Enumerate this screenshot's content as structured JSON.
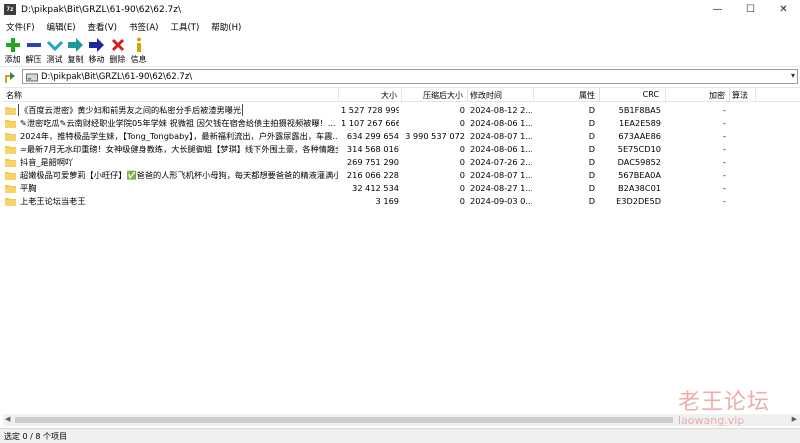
{
  "window": {
    "app_icon_text": "7z",
    "title": "D:\\pikpak\\Bit\\GRZL\\61-90\\62\\62.7z\\",
    "controls": [
      "—",
      "☐",
      "✕"
    ]
  },
  "menu": [
    "文件(F)",
    "编辑(E)",
    "查看(V)",
    "书签(A)",
    "工具(T)",
    "帮助(H)"
  ],
  "toolbar": [
    {
      "label": "添加",
      "icon": "add-icon",
      "color": "#22a722"
    },
    {
      "label": "解压",
      "icon": "extract-icon",
      "color": "#2a3fc9"
    },
    {
      "label": "测试",
      "icon": "test-icon",
      "color": "#20a8c8"
    },
    {
      "label": "复制",
      "icon": "copy-icon",
      "color": "#1a9a9a"
    },
    {
      "label": "移动",
      "icon": "move-icon",
      "color": "#1b2a9a"
    },
    {
      "label": "删除",
      "icon": "delete-icon",
      "color": "#d42020"
    },
    {
      "label": "信息",
      "icon": "info-icon",
      "color": "#d4a400"
    }
  ],
  "address": {
    "path": "D:\\pikpak\\Bit\\GRZL\\61-90\\62\\62.7z\\"
  },
  "columns": {
    "name": "名称",
    "size": "大小",
    "packed": "压缩后大小",
    "modified": "修改时间",
    "attributes": "属性",
    "crc": "CRC",
    "encrypted": "加密",
    "method": "算法"
  },
  "rows": [
    {
      "name": "《百度云泄密》黄少妇和前男友之间的私密分手后被渣男曝光",
      "size": "1 527 728 999",
      "packed": "0",
      "modified": "2024-08-12 2...",
      "attr": "D",
      "crc": "5B1F8BA5",
      "enc": "-",
      "selected": true
    },
    {
      "name": "✎泄密吃瓜✎云南财经职业学院05年学妹 祝微祖 因欠钱在宿舍给债主拍摄视频被曝！...",
      "size": "1 107 267 666",
      "packed": "0",
      "modified": "2024-08-06 1...",
      "attr": "D",
      "crc": "1EA2E589",
      "enc": "-",
      "selected": false
    },
    {
      "name": "2024年，推特极品学生妹，【Tong_Tongbaby】，最新福利流出，户外露尿露出，车震...",
      "size": "634 299 654",
      "packed": "3 990 537 072",
      "modified": "2024-08-07 1...",
      "attr": "D",
      "crc": "673AAE86",
      "enc": "-",
      "selected": false
    },
    {
      "name": "=最新7月无水印重磅！女神级健身教练，大长腿御姐【梦琪】线下外围土豪，各种情趣全...",
      "size": "314 568 016",
      "packed": "0",
      "modified": "2024-08-06 1...",
      "attr": "D",
      "crc": "5E75CD10",
      "enc": "-",
      "selected": false
    },
    {
      "name": "抖音_是韶啊吖",
      "size": "269 751 290",
      "packed": "0",
      "modified": "2024-07-26 2...",
      "attr": "D",
      "crc": "DAC59852",
      "enc": "-",
      "selected": false
    },
    {
      "name": "超嫩极品可爱萝莉【小旺仔】✅爸爸的人形飞机杯小母狗，每天都想要爸爸的精液灌满小...",
      "size": "216 066 228",
      "packed": "0",
      "modified": "2024-08-07 1...",
      "attr": "D",
      "crc": "567BEA0A",
      "enc": "-",
      "selected": false
    },
    {
      "name": "平胸",
      "size": "32 412 534",
      "packed": "0",
      "modified": "2024-08-27 1...",
      "attr": "D",
      "crc": "B2A38C01",
      "enc": "-",
      "selected": false
    },
    {
      "name": "上老王论坛当老王",
      "size": "3 169",
      "packed": "0",
      "modified": "2024-09-03 0...",
      "attr": "D",
      "crc": "E3D2DE5D",
      "enc": "-",
      "selected": false
    }
  ],
  "status": {
    "text": "选定 0 / 8 个项目"
  },
  "watermark": {
    "line1": "老王论坛",
    "line2": "laowang.vip"
  }
}
